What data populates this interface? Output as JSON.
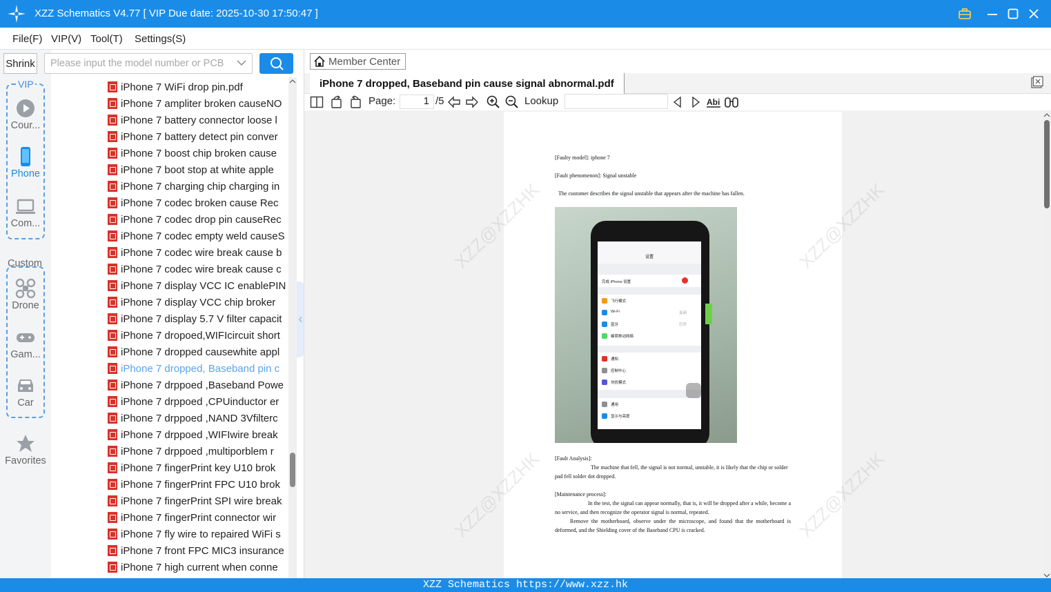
{
  "window": {
    "title": "XZZ Schematics V4.77 [ VIP Due date: 2025-10-30 17:50:47 ]"
  },
  "menu": [
    "File(F)",
    "VIP(V)",
    "Tool(T)",
    "Settings(S)"
  ],
  "search": {
    "shrink_label": "Shrink",
    "placeholder": "Please input the model number or PCB"
  },
  "nav": {
    "vip_caption": "VIP",
    "vip_items": [
      "Cour...",
      "Phone",
      "Com..."
    ],
    "custom_caption": "Custom",
    "custom_items": [
      "Drone",
      "Gam...",
      "Car"
    ],
    "favorites": "Favorites",
    "active": "Phone"
  },
  "files": [
    "iPhone 7 WiFi drop pin.pdf",
    "iPhone 7 ampliter broken causeNO",
    "iPhone 7 battery connector loose l",
    "iPhone 7 battery detect pin conver",
    "iPhone 7 boost chip  broken cause",
    "iPhone 7 boot stop at white apple",
    "iPhone 7 charging chip charging in",
    "iPhone 7 codec  broken cause Rec",
    "iPhone 7 codec drop pin causeRec",
    "iPhone 7 codec empty weld causeS",
    "iPhone 7 codec wire break cause b",
    "iPhone 7 codec wire break cause c",
    "iPhone 7 display  VCC IC enablePIN",
    "iPhone 7 display  VCC chip  broker",
    "iPhone 7 display 5.7 V filter capacit",
    "iPhone 7 dropoed,WIFIcircuit short",
    "iPhone 7 dropped causewhite appl",
    "iPhone 7 dropped, Baseband pin c",
    "iPhone 7 drppoed ,Baseband Powe",
    "iPhone 7 drppoed ,CPUinductor er",
    "iPhone 7 drppoed ,NAND 3Vfilterc",
    "iPhone 7 drppoed ,WIFIwire break",
    "iPhone 7 drppoed ,multiporblem r",
    "iPhone 7 fingerPrint  key U10 brok",
    "iPhone 7 fingerPrint FPC U10 brok",
    "iPhone 7 fingerPrint SPI wire break",
    "iPhone 7 fingerPrint connector wir",
    "iPhone 7 fly wire to repaired WiFi s",
    "iPhone 7 front FPC MIC3 insurance",
    "iPhone 7 high current when conne"
  ],
  "selected_file_index": 17,
  "viewer": {
    "member_center": "Member Center",
    "tab_title": "iPhone 7 dropped, Baseband pin cause signal abnormal.pdf",
    "page_label": "Page:",
    "page_current": "1",
    "page_total": "/5",
    "lookup_label": "Lookup",
    "lookup_value": ""
  },
  "document": {
    "faulty_model": "[Faulty model]: iphone 7",
    "fault_phenomenon": "[Fault phenomenon]: Signal unstable",
    "description": "The customer describes the signal unstable that appears after the machine has fallen.",
    "analysis_heading": "[Fault Analysis]:",
    "analysis_text": "The machine that fell, the signal is not normal, unstable, it is likely that the chip or solder pad fell solder dot dropped.",
    "maintenance_heading": "[Maintenance process]:",
    "maintenance_text_1": "In the test, the signal can appear normally, that is, it will be dropped after a while, become a no service, and then recognize the operator signal is normal, repeated.",
    "maintenance_text_2": "Remove the motherboard, observe under the microscope, and found that the motherboard is deformed, and the Shielding cover of the Baseband CPU is cracked.",
    "watermark": "XZZ@XZZHK",
    "phone_screen": {
      "header": "设置",
      "banner": "完成 iPhone 设置",
      "rows": [
        "飞行模式",
        "Wi-Fi",
        "蓝牙",
        "蜂窝移动网络",
        "通知",
        "控制中心",
        "勿扰模式",
        "通用",
        "显示与亮度"
      ],
      "wifi_value": "关闭",
      "bt_value": "打开"
    }
  },
  "footer": "XZZ Schematics https://www.xzz.hk",
  "colors": {
    "accent": "#1a8ce8",
    "pdf_icon": "#d8322a",
    "selected_text": "#5aa3ec"
  }
}
